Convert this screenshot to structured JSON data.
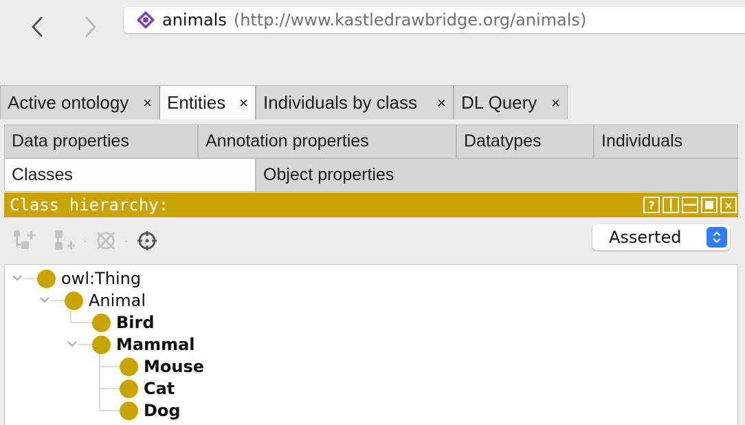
{
  "navigation": {
    "back_icon": "chevron-left-icon",
    "forward_icon": "chevron-right-icon"
  },
  "address": {
    "icon": "ontology-diamond-icon",
    "name": "animals",
    "iri": "(http://www.kastledrawbridge.org/animals)"
  },
  "workspace_tabs": [
    {
      "label": "Active ontology",
      "close": "×",
      "active": false
    },
    {
      "label": "Entities",
      "close": "×",
      "active": true
    },
    {
      "label": "Individuals by class",
      "close": "×",
      "active": false
    },
    {
      "label": "DL Query",
      "close": "×",
      "active": false
    }
  ],
  "entity_tabs": {
    "row1": [
      "Data properties",
      "Annotation properties",
      "Datatypes",
      "Individuals"
    ],
    "row2": [
      "Classes",
      "Object properties"
    ],
    "active": "Classes"
  },
  "view": {
    "title": "Class hierarchy:",
    "buttons": [
      "?",
      "",
      "",
      "",
      "×"
    ],
    "accent_color": "#c9a400"
  },
  "toolbar": {
    "icons": [
      "add-subclass-icon",
      "add-sibling-class-icon",
      "delete-class-icon",
      "find-target-icon"
    ]
  },
  "hierarchy_mode": {
    "selected": "Asserted"
  },
  "tree": {
    "nodes": [
      {
        "label": "owl:Thing",
        "depth": 0,
        "expanded": true,
        "bold": false
      },
      {
        "label": "Animal",
        "depth": 1,
        "expanded": true,
        "bold": false
      },
      {
        "label": "Bird",
        "depth": 2,
        "expanded": false,
        "bold": true
      },
      {
        "label": "Mammal",
        "depth": 2,
        "expanded": true,
        "bold": true
      },
      {
        "label": "Mouse",
        "depth": 3,
        "expanded": false,
        "bold": true
      },
      {
        "label": "Cat",
        "depth": 3,
        "expanded": false,
        "bold": true
      },
      {
        "label": "Dog",
        "depth": 3,
        "expanded": false,
        "bold": true
      }
    ]
  }
}
